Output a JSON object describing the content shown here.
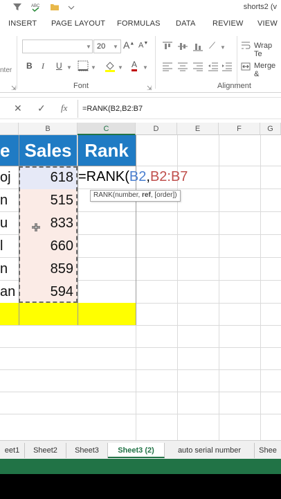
{
  "window": {
    "title": "shorts2 (v"
  },
  "ribbon_tabs": [
    "INSERT",
    "PAGE LAYOUT",
    "FORMULAS",
    "DATA",
    "REVIEW",
    "VIEW"
  ],
  "ribbon": {
    "font_size": "20",
    "font_group_label": "Font",
    "alignment_group_label": "Alignment",
    "wrap_text_label": "Wrap Te",
    "merge_label": "Merge &",
    "enter_partial": "nter",
    "bold": "B",
    "italic": "I",
    "underline": "U",
    "font_color": "A"
  },
  "formula_bar": {
    "cancel": "✕",
    "enter": "✓",
    "fx": "fx",
    "content": "=RANK(B2,B2:B7"
  },
  "columns": [
    "B",
    "C",
    "D",
    "E",
    "F",
    "G"
  ],
  "table": {
    "header_name_partial": "e",
    "header_sales": "Sales",
    "header_rank": "Rank",
    "rows": [
      {
        "name": "oj",
        "sales": "618"
      },
      {
        "name": "n",
        "sales": "515"
      },
      {
        "name": "u",
        "sales": "833"
      },
      {
        "name": "l",
        "sales": "660"
      },
      {
        "name": "n",
        "sales": "859"
      },
      {
        "name": "an",
        "sales": "594"
      }
    ]
  },
  "formula_cell": {
    "prefix": "=RANK(",
    "arg1": "B2",
    "comma": ",",
    "arg2": "B2:B7",
    "arg1_color": "#4a7fd0",
    "arg2_color": "#c0504d"
  },
  "tooltip": {
    "fn": "RANK(number, ",
    "bold": "ref",
    "rest": ", [order])"
  },
  "sheet_tabs": [
    "eet1",
    "Sheet2",
    "Sheet3",
    "Sheet3 (2)",
    "auto serial number",
    "Shee"
  ],
  "active_sheet": "Sheet3 (2)",
  "colors": {
    "header_blue": "#1f7bc4",
    "sales_fill": "#fbebe6",
    "yellow": "#ffff00",
    "excel_green": "#217346"
  }
}
